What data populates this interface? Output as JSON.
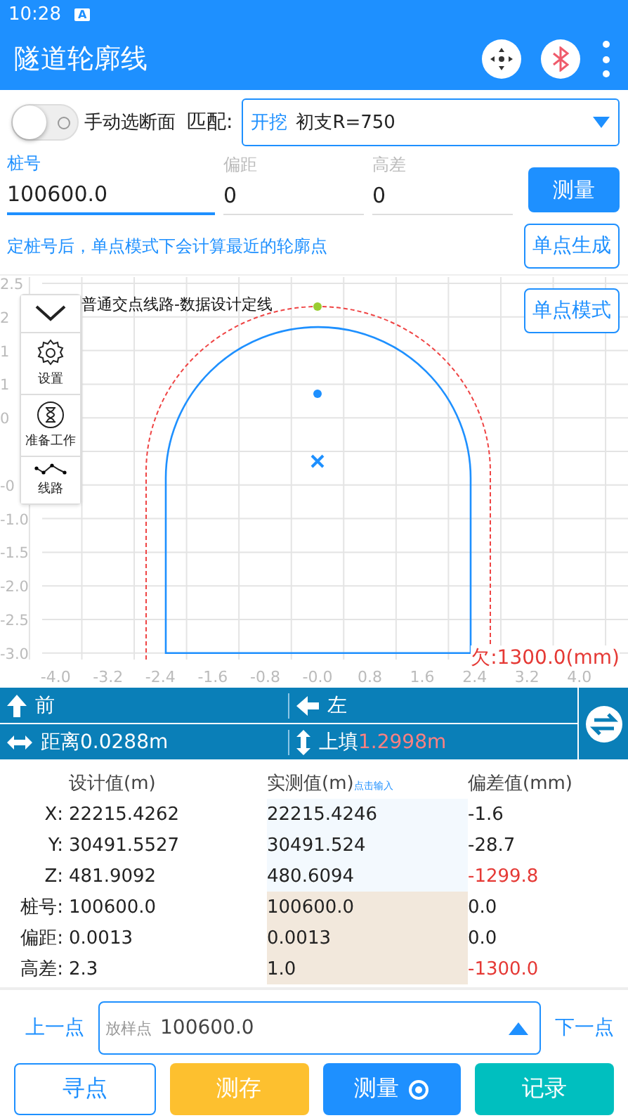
{
  "status_bar": {
    "time": "10:28",
    "badge": "A"
  },
  "app_bar": {
    "title": "隧道轮廓线"
  },
  "controls": {
    "toggle": {
      "label": "手动选断面",
      "on": false
    },
    "match_label": "匹配:",
    "match": {
      "tag": "开挖",
      "value": "初支R=750"
    },
    "fields": [
      {
        "label": "桩号",
        "value": "100600.0",
        "focused": true
      },
      {
        "label": "偏距",
        "value": "0",
        "focused": false
      },
      {
        "label": "高差",
        "value": "0",
        "focused": false
      }
    ],
    "measure_button": "测量",
    "hint": "定桩号后，单点模式下会计算最近的轮廓点",
    "generate_button": "单点生成"
  },
  "plot": {
    "title": "普通交点线路-数据设计定线",
    "mode_button": "单点模式",
    "shortfall": "欠:1300.0(mm)",
    "y_ticks": [
      "2.5",
      "2",
      "1",
      "1",
      "0",
      "-0",
      "-1.0",
      "-1.5",
      "-2.0",
      "-2.5",
      "-3.0"
    ],
    "x_ticks": [
      "-4.0",
      "-3.2",
      "-2.4",
      "-1.6",
      "-0.8",
      "-0.0",
      "0.8",
      "1.6",
      "2.4",
      "3.2",
      "4.0"
    ],
    "side_menu": [
      {
        "kind": "collapse"
      },
      {
        "kind": "settings",
        "label": "设置"
      },
      {
        "kind": "prepare",
        "label": "准备工作"
      },
      {
        "kind": "route",
        "label": "线路"
      }
    ]
  },
  "guidance": {
    "forward": "前",
    "left": "左",
    "distance": "距离0.0288m",
    "fill_label": "上填",
    "fill_value": "1.2998m"
  },
  "table": {
    "columns": [
      "设计值(m)",
      "实测值(m)",
      "偏差值(mm)"
    ],
    "input_hint": "点击输入",
    "rows": [
      {
        "label": "X:",
        "kind": "coordinate",
        "design": "22215.4262",
        "measured": "22215.4246",
        "deviation": "-1.6",
        "alert": false
      },
      {
        "label": "Y:",
        "kind": "coordinate",
        "design": "30491.5527",
        "measured": "30491.524",
        "deviation": "-28.7",
        "alert": false
      },
      {
        "label": "Z:",
        "kind": "coordinate",
        "design": "481.9092",
        "measured": "480.6094",
        "deviation": "-1299.8",
        "alert": true
      },
      {
        "label": "桩号:",
        "kind": "station",
        "design": "100600.0",
        "measured": "100600.0",
        "deviation": "0.0",
        "alert": false
      },
      {
        "label": "偏距:",
        "kind": "station",
        "design": "0.0013",
        "measured": "0.0013",
        "deviation": "0.0",
        "alert": false
      },
      {
        "label": "高差:",
        "kind": "station",
        "design": "2.3",
        "measured": "1.0",
        "deviation": "-1300.0",
        "alert": true
      }
    ]
  },
  "point_nav": {
    "previous": "上一点",
    "field_label": "放样点",
    "field_value": "100600.0",
    "next": "下一点"
  },
  "actions": [
    {
      "kind": "outline",
      "label": "寻点"
    },
    {
      "kind": "amber",
      "label": "测存"
    },
    {
      "kind": "blue",
      "label": "测量"
    },
    {
      "kind": "teal",
      "label": "记录"
    }
  ]
}
